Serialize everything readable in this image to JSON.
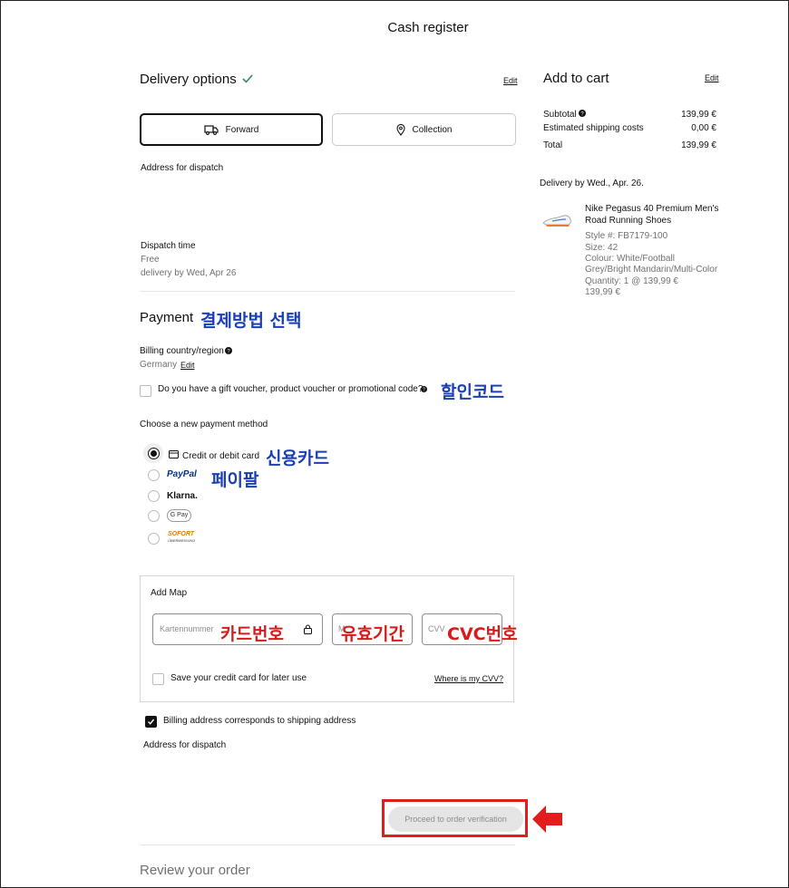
{
  "page_title": "Cash register",
  "delivery": {
    "title": "Delivery options",
    "edit": "Edit",
    "tabs": [
      {
        "label": "Forward",
        "icon": "truck-icon"
      },
      {
        "label": "Collection",
        "icon": "location-pin-icon"
      }
    ],
    "address_label": "Address for dispatch",
    "dispatch_time_label": "Dispatch time",
    "dispatch_cost": "Free",
    "dispatch_date": "delivery by Wed, Apr 26"
  },
  "payment": {
    "title": "Payment",
    "billing_label": "Billing country/region",
    "billing_country": "Germany",
    "billing_edit": "Edit",
    "promo_label": "Do you have a gift voucher, product voucher or promotional code?",
    "choose_label": "Choose a new payment method",
    "methods": [
      {
        "label": "Credit or debit card",
        "icon": "card-icon",
        "selected": true
      },
      {
        "label": "PayPal",
        "icon": "paypal-logo"
      },
      {
        "label": "Klarna.",
        "icon": "klarna-logo"
      },
      {
        "label": "G Pay",
        "icon": "google-pay-logo"
      },
      {
        "label": "SOFORT",
        "sub": "ÜBERWEISUNG",
        "icon": "sofort-logo"
      }
    ],
    "card_form": {
      "title": "Add Map",
      "card_number_placeholder": "Kartennummer",
      "expiry_placeholder": "M",
      "cvv_placeholder": "CVV",
      "save_card_label": "Save your credit card for later use",
      "cvv_help": "Where is my CVV?"
    },
    "billing_same_label": "Billing address corresponds to shipping address",
    "address_label": "Address for dispatch",
    "proceed_button": "Proceed to order verification"
  },
  "review_title": "Review your order",
  "cart": {
    "title": "Add to cart",
    "edit": "Edit",
    "subtotal_label": "Subtotal",
    "subtotal_value": "139,99 €",
    "shipping_label": "Estimated shipping costs",
    "shipping_value": "0,00 €",
    "total_label": "Total",
    "total_value": "139,99 €",
    "delivery_by": "Delivery by Wed., Apr. 26.",
    "product": {
      "name": "Nike Pegasus 40 Premium Men's Road Running Shoes",
      "style": "Style #: FB7179-100",
      "size": "Size: 42",
      "colour": "Colour: White/Football Grey/Bright Mandarin/Multi-Color",
      "quantity": "Quantity: 1 @ 139,99 €",
      "price": "139,99 €"
    }
  },
  "annotations": {
    "payment_method": "결제방법 선택",
    "discount_code": "할인코드",
    "credit_card": "신용카드",
    "paypal": "페이팔",
    "card_number": "카드번호",
    "expiry": "유효기간",
    "cvc": "CVC번호"
  },
  "colors": {
    "annotation_blue": "#1a3fb5",
    "annotation_red": "#d91a1a",
    "check_green": "#2e8b57"
  }
}
